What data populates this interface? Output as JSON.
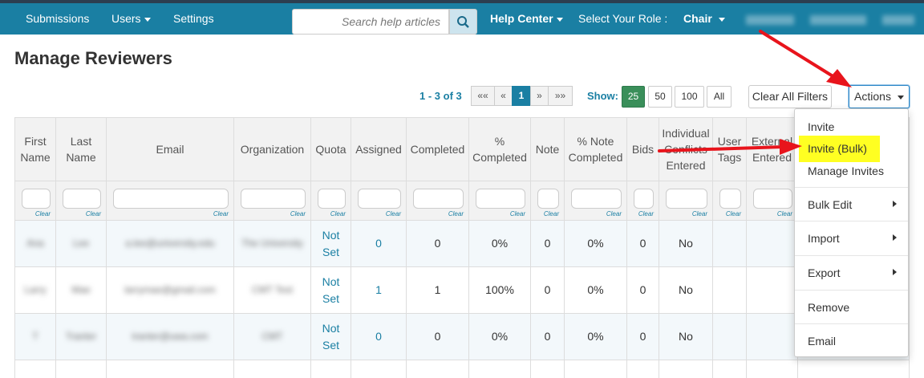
{
  "nav": {
    "submissions": "Submissions",
    "users": "Users",
    "settings": "Settings",
    "search_placeholder": "Search help articles",
    "help_center": "Help Center",
    "select_role": "Select Your Role :",
    "role": "Chair"
  },
  "page_title": "Manage Reviewers",
  "pager": {
    "range_prefix": "1 - 3 of ",
    "total": "3",
    "first": "««",
    "prev": "«",
    "current": "1",
    "next": "»",
    "last": "»»"
  },
  "show": {
    "label": "Show:",
    "options": [
      "25",
      "50",
      "100",
      "All"
    ],
    "selected": "25"
  },
  "buttons": {
    "clear_filters": "Clear All Filters",
    "actions": "Actions"
  },
  "filter_clear": "Clear",
  "columns": [
    "First Name",
    "Last Name",
    "Email",
    "Organization",
    "Quota",
    "Assigned",
    "Completed",
    "% Completed",
    "Note",
    "% Note Completed",
    "Bids",
    "Individual Conflicts Entered",
    "User Tags",
    "External Entered"
  ],
  "rows": [
    {
      "first": "Ana",
      "last": "Lee",
      "email": "a.lee@university.edu",
      "org": "The University",
      "quota": "Not Set",
      "assigned": "0",
      "completed": "0",
      "pct": "0%",
      "note": "0",
      "pct_note": "0%",
      "bids": "0",
      "conflicts": "No"
    },
    {
      "first": "Larry",
      "last": "Mae",
      "email": "larrymae@gmail.com",
      "org": "CMT Test",
      "quota": "Not Set",
      "assigned": "1",
      "completed": "1",
      "pct": "100%",
      "note": "0",
      "pct_note": "0%",
      "bids": "0",
      "conflicts": "No"
    },
    {
      "first": "T",
      "last": "Tranter",
      "email": "tranter@uwa.com",
      "org": "CMT",
      "quota": "Not Set",
      "assigned": "0",
      "completed": "0",
      "pct": "0%",
      "note": "0",
      "pct_note": "0%",
      "bids": "0",
      "conflicts": "No"
    }
  ],
  "menu": {
    "invite": "Invite",
    "invite_bulk": "Invite (Bulk)",
    "manage_invites": "Manage Invites",
    "bulk_edit": "Bulk Edit",
    "import": "Import",
    "export": "Export",
    "remove": "Remove",
    "email": "Email"
  },
  "colors": {
    "brand": "#1a7fa3",
    "highlight": "#ffff22",
    "arrow": "#e8141c",
    "show_active": "#3a8f5a"
  }
}
